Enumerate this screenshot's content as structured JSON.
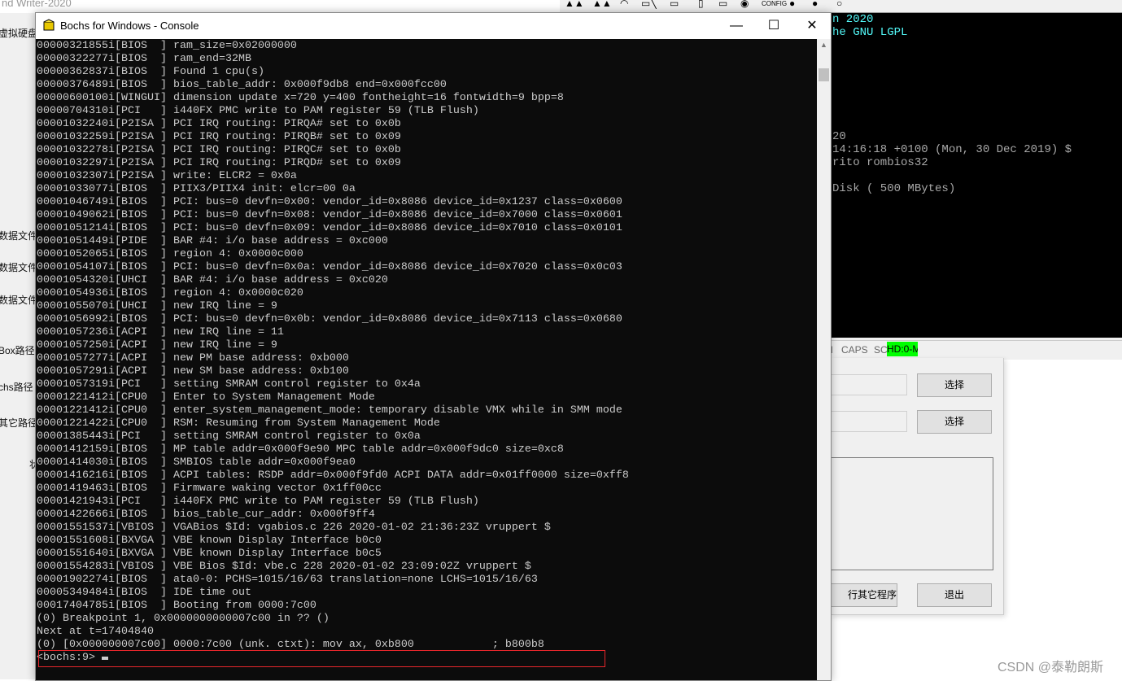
{
  "background_app": {
    "title": "nd Writer-2020",
    "labels": [
      "虚拟硬盘文",
      "数据文件",
      "数据文件",
      "数据文件",
      "Box路径",
      "chs路径",
      "其它路径",
      "状"
    ]
  },
  "bochs_main": {
    "toolbar_config_label": "CONFIG",
    "screen_lines": [
      {
        "text": "n 2020",
        "color": "#54fcfc"
      },
      {
        "text": "he GNU LGPL",
        "color": "#54fcfc"
      },
      {
        "text": "20",
        "color": "#a8a8a8"
      },
      {
        "text": "14:16:18 +0100 (Mon, 30 Dec 2019) $",
        "color": "#a8a8a8"
      },
      {
        "text": "rito rombios32",
        "color": "#a8a8a8"
      },
      {
        "text": "Disk ( 500 MBytes)",
        "color": "#a8a8a8"
      }
    ],
    "status": {
      "num": "l",
      "caps": "CAPS",
      "scrl": "SCRL",
      "hd": "HD:0-M"
    },
    "hd_color": "#00ff00"
  },
  "dialog": {
    "select_button_1": "选择",
    "select_button_2": "选择",
    "run_other_button": "行其它程序",
    "exit_button": "退出"
  },
  "watermark": "CSDN @泰勒朗斯",
  "console": {
    "title": "Bochs for Windows - Console",
    "minimize": "—",
    "maximize": "☐",
    "close": "✕",
    "lines": [
      "00000321855i[BIOS  ] ram_size=0x02000000",
      "00000322277i[BIOS  ] ram_end=32MB",
      "00000362837i[BIOS  ] Found 1 cpu(s)",
      "00000376489i[BIOS  ] bios_table_addr: 0x000f9db8 end=0x000fcc00",
      "00000600100i[WINGUI] dimension update x=720 y=400 fontheight=16 fontwidth=9 bpp=8",
      "00000704310i[PCI   ] i440FX PMC write to PAM register 59 (TLB Flush)",
      "00001032240i[P2ISA ] PCI IRQ routing: PIRQA# set to 0x0b",
      "00001032259i[P2ISA ] PCI IRQ routing: PIRQB# set to 0x09",
      "00001032278i[P2ISA ] PCI IRQ routing: PIRQC# set to 0x0b",
      "00001032297i[P2ISA ] PCI IRQ routing: PIRQD# set to 0x09",
      "00001032307i[P2ISA ] write: ELCR2 = 0x0a",
      "00001033077i[BIOS  ] PIIX3/PIIX4 init: elcr=00 0a",
      "00001046749i[BIOS  ] PCI: bus=0 devfn=0x00: vendor_id=0x8086 device_id=0x1237 class=0x0600",
      "00001049062i[BIOS  ] PCI: bus=0 devfn=0x08: vendor_id=0x8086 device_id=0x7000 class=0x0601",
      "00001051214i[BIOS  ] PCI: bus=0 devfn=0x09: vendor_id=0x8086 device_id=0x7010 class=0x0101",
      "00001051449i[PIDE  ] BAR #4: i/o base address = 0xc000",
      "00001052065i[BIOS  ] region 4: 0x0000c000",
      "00001054107i[BIOS  ] PCI: bus=0 devfn=0x0a: vendor_id=0x8086 device_id=0x7020 class=0x0c03",
      "00001054320i[UHCI  ] BAR #4: i/o base address = 0xc020",
      "00001054936i[BIOS  ] region 4: 0x0000c020",
      "00001055070i[UHCI  ] new IRQ line = 9",
      "00001056992i[BIOS  ] PCI: bus=0 devfn=0x0b: vendor_id=0x8086 device_id=0x7113 class=0x0680",
      "00001057236i[ACPI  ] new IRQ line = 11",
      "00001057250i[ACPI  ] new IRQ line = 9",
      "00001057277i[ACPI  ] new PM base address: 0xb000",
      "00001057291i[ACPI  ] new SM base address: 0xb100",
      "00001057319i[PCI   ] setting SMRAM control register to 0x4a",
      "00001221412i[CPU0  ] Enter to System Management Mode",
      "00001221412i[CPU0  ] enter_system_management_mode: temporary disable VMX while in SMM mode",
      "00001221422i[CPU0  ] RSM: Resuming from System Management Mode",
      "00001385443i[PCI   ] setting SMRAM control register to 0x0a",
      "00001412159i[BIOS  ] MP table addr=0x000f9e90 MPC table addr=0x000f9dc0 size=0xc8",
      "00001414030i[BIOS  ] SMBIOS table addr=0x000f9ea0",
      "00001416216i[BIOS  ] ACPI tables: RSDP addr=0x000f9fd0 ACPI DATA addr=0x01ff0000 size=0xff8",
      "00001419463i[BIOS  ] Firmware waking vector 0x1ff00cc",
      "00001421943i[PCI   ] i440FX PMC write to PAM register 59 (TLB Flush)",
      "00001422666i[BIOS  ] bios_table_cur_addr: 0x000f9ff4",
      "00001551537i[VBIOS ] VGABios $Id: vgabios.c 226 2020-01-02 21:36:23Z vruppert $",
      "00001551608i[BXVGA ] VBE known Display Interface b0c0",
      "00001551640i[BXVGA ] VBE known Display Interface b0c5",
      "00001554283i[VBIOS ] VBE Bios $Id: vbe.c 228 2020-01-02 23:09:02Z vruppert $",
      "00001902274i[BIOS  ] ata0-0: PCHS=1015/16/63 translation=none LCHS=1015/16/63",
      "00005349484i[BIOS  ] IDE time out",
      "00017404785i[BIOS  ] Booting from 0000:7c00",
      "(0) Breakpoint 1, 0x0000000000007c00 in ?? ()",
      "Next at t=17404840",
      "(0) [0x000000007c00] 0000:7c00 (unk. ctxt): mov ax, 0xb800            ; b800b8"
    ],
    "prompt": "<bochs:9> ",
    "highlight_color": "#e8262b"
  }
}
